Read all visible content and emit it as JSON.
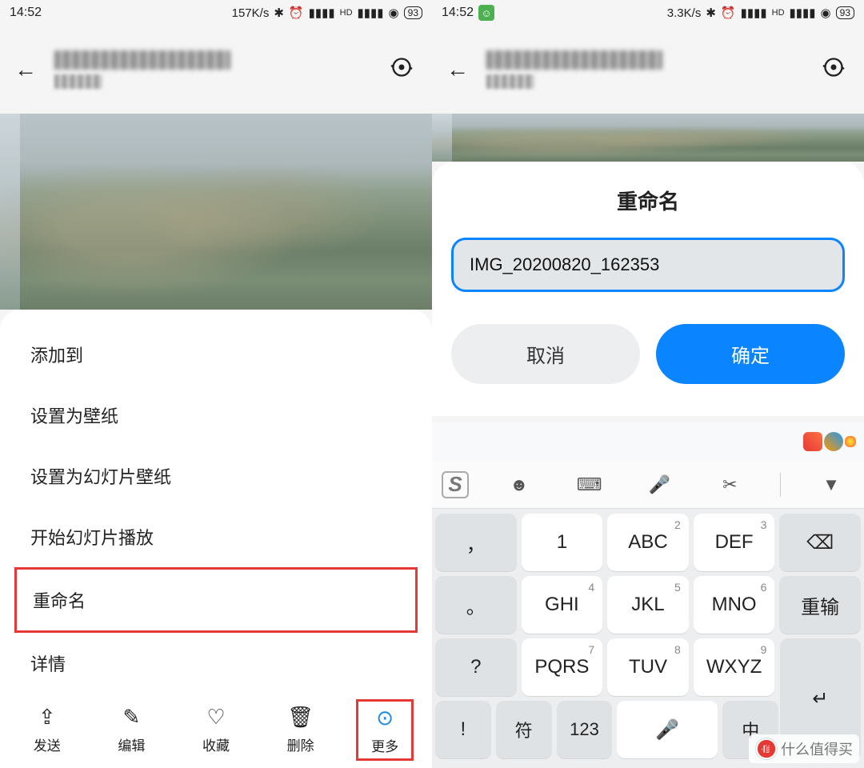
{
  "left": {
    "status": {
      "time": "14:52",
      "speed": "157K/s",
      "battery": "93"
    },
    "menu": {
      "items": [
        "添加到",
        "设置为壁纸",
        "设置为幻灯片壁纸",
        "开始幻灯片播放",
        "重命名",
        "详情"
      ],
      "highlighted_index": 4
    },
    "toolbar": {
      "items": [
        {
          "label": "发送",
          "icon": "share"
        },
        {
          "label": "编辑",
          "icon": "edit"
        },
        {
          "label": "收藏",
          "icon": "heart"
        },
        {
          "label": "删除",
          "icon": "trash"
        },
        {
          "label": "更多",
          "icon": "more"
        }
      ],
      "highlighted_index": 4
    }
  },
  "right": {
    "status": {
      "time": "14:52",
      "speed": "3.3K/s",
      "battery": "93"
    },
    "dialog": {
      "title": "重命名",
      "input_value": "IMG_20200820_162353",
      "cancel": "取消",
      "confirm": "确定"
    },
    "keyboard": {
      "row1": [
        {
          "sym": "，",
          "main": "",
          "sup": ""
        },
        {
          "main": "1",
          "sup": ""
        },
        {
          "main": "ABC",
          "sup": "2"
        },
        {
          "main": "DEF",
          "sup": "3"
        },
        {
          "main": "⌫",
          "side": true
        }
      ],
      "row2": [
        {
          "sym": "。",
          "main": "",
          "sup": ""
        },
        {
          "main": "GHI",
          "sup": "4"
        },
        {
          "main": "JKL",
          "sup": "5"
        },
        {
          "main": "MNO",
          "sup": "6"
        },
        {
          "main": "重输",
          "side": true
        }
      ],
      "row3": [
        {
          "sym": "?",
          "main": "",
          "sup": ""
        },
        {
          "main": "PQRS",
          "sup": "7"
        },
        {
          "main": "TUV",
          "sup": "8"
        },
        {
          "main": "WXYZ",
          "sup": "9"
        }
      ],
      "row4": [
        {
          "sym": "!",
          "main": "",
          "sup": ""
        },
        {
          "main": "符",
          "func": true
        },
        {
          "main": "123",
          "func": true
        },
        {
          "main": "mic",
          "icon": true,
          "space": true
        },
        {
          "main": "中",
          "func": true
        },
        {
          "main": "↵",
          "side": true
        }
      ]
    }
  },
  "watermark": {
    "text": "什么值得买",
    "badge": "值"
  }
}
